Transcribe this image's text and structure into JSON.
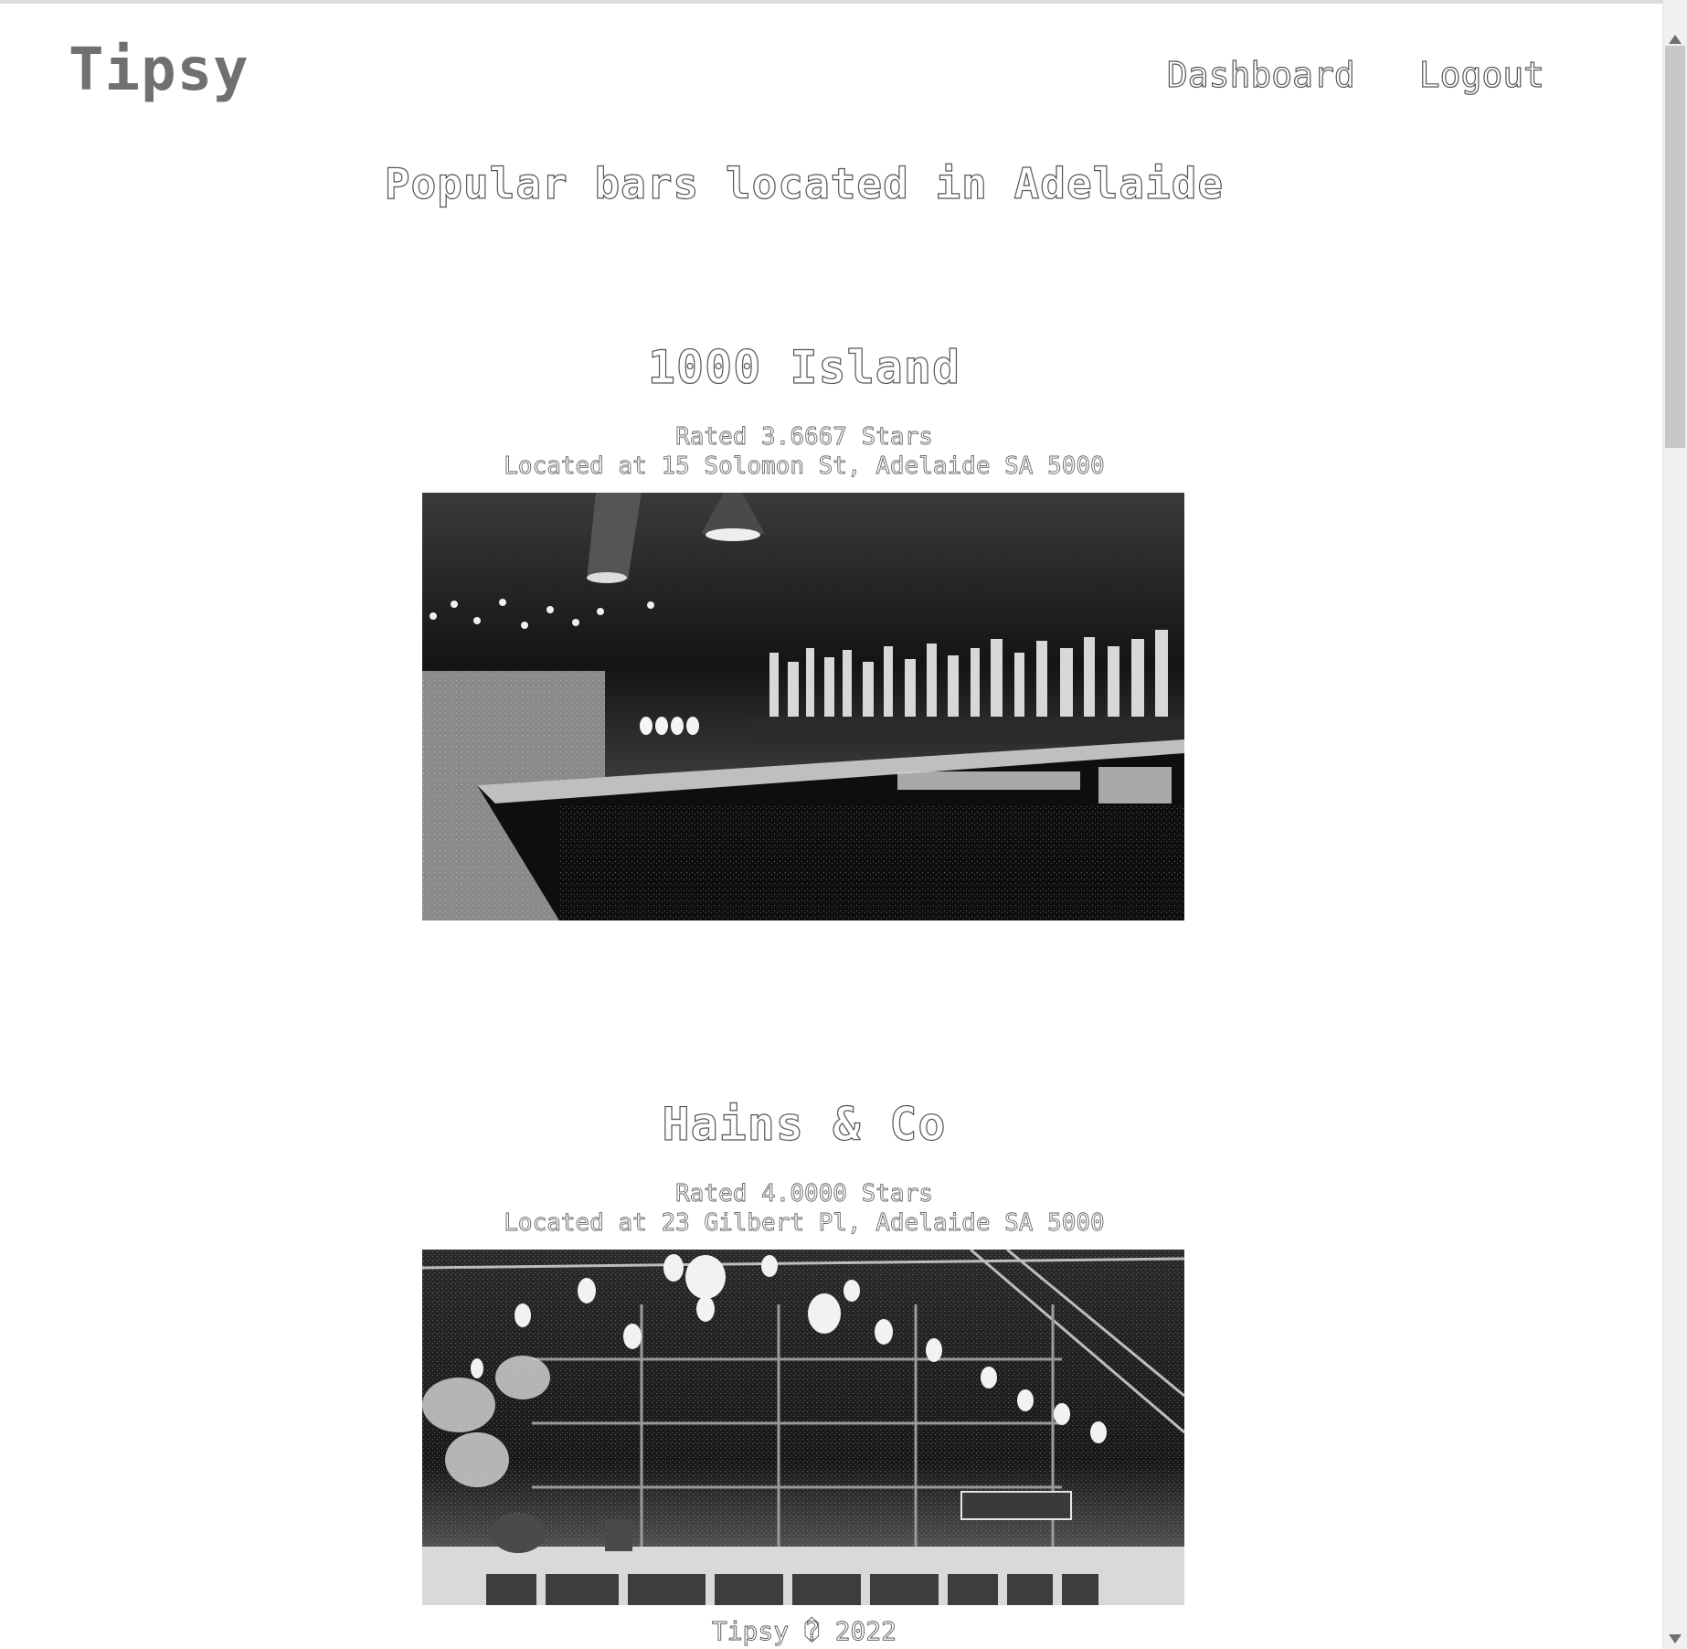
{
  "header": {
    "brand": "Tipsy",
    "nav": [
      {
        "label": "Dashboard"
      },
      {
        "label": "Logout"
      }
    ]
  },
  "main": {
    "headline": "Popular bars located in Adelaide",
    "bars": [
      {
        "name": "1000 Island",
        "rating_text": "Rated 3.6667 Stars",
        "address_text": "Located at 15 Solomon St, Adelaide SA 5000"
      },
      {
        "name": "Hains & Co",
        "rating_text": "Rated 4.0000 Stars",
        "address_text": "Located at 23 Gilbert Pl, Adelaide SA 5000"
      }
    ]
  },
  "footer": {
    "text": "Tipsy � 2022"
  }
}
